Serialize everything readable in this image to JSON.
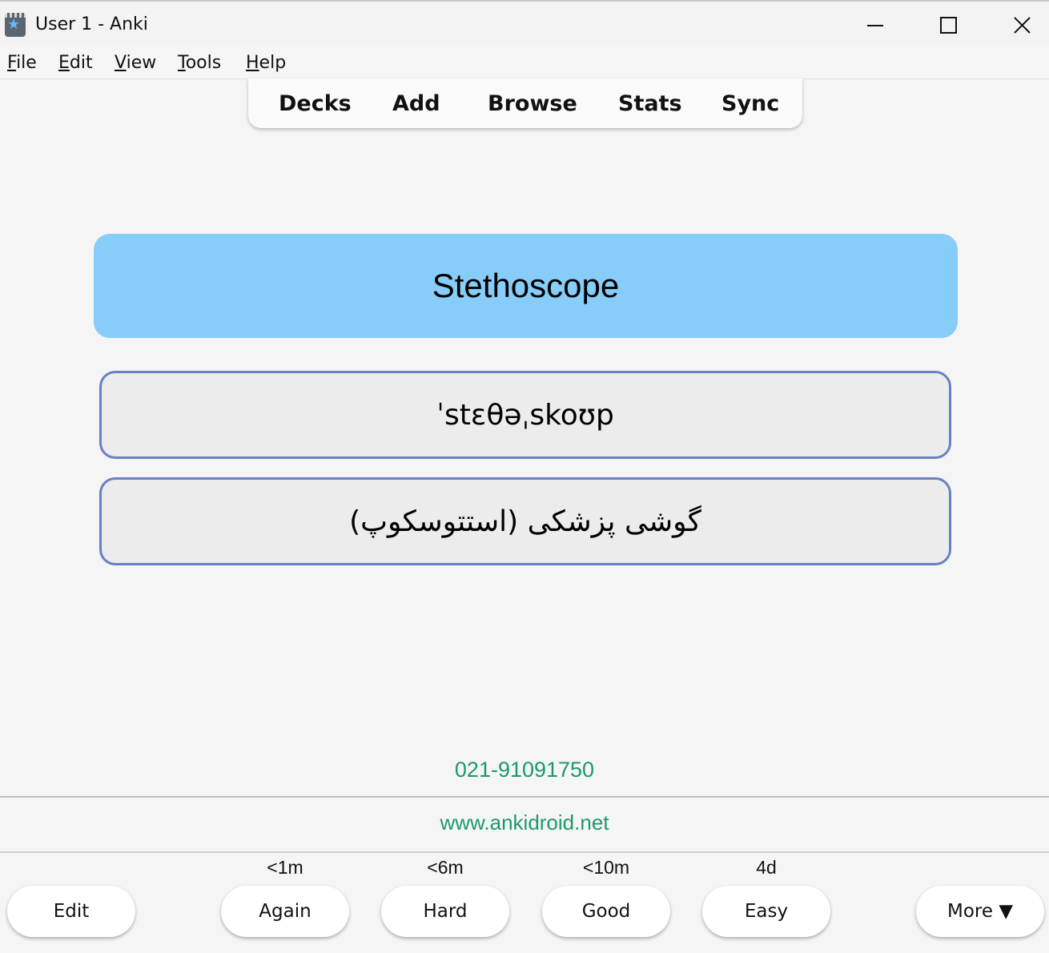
{
  "window": {
    "title": "User 1 - Anki"
  },
  "menu": [
    {
      "mnemonic": "F",
      "rest": "ile"
    },
    {
      "mnemonic": "E",
      "rest": "dit"
    },
    {
      "mnemonic": "V",
      "rest": "iew"
    },
    {
      "mnemonic": "T",
      "rest": "ools"
    },
    {
      "mnemonic": "H",
      "rest": "elp"
    }
  ],
  "toolbar": [
    "Decks",
    "Add",
    "Browse",
    "Stats",
    "Sync"
  ],
  "card": {
    "front": "Stethoscope",
    "pronunciation": "ˈstɛθəˌskoʊp",
    "translation": "گوشی پزشکی (استتوسکوپ)"
  },
  "footer": {
    "phone": "021-91091750",
    "website": "www.ankidroid.net"
  },
  "answer": {
    "edit_label": "Edit",
    "more_label": "More ▼",
    "buttons": [
      {
        "label": "Again",
        "interval": "<1m"
      },
      {
        "label": "Hard",
        "interval": "<6m"
      },
      {
        "label": "Good",
        "interval": "<10m"
      },
      {
        "label": "Easy",
        "interval": "4d"
      }
    ]
  },
  "colors": {
    "card_front_bg": "#87cdfa",
    "card_border": "#6a80c2",
    "footer_text": "#1a9a6a"
  },
  "icons": {
    "app": "anki-icon",
    "minimize": "minimize-icon",
    "maximize": "maximize-icon",
    "close": "close-icon"
  }
}
